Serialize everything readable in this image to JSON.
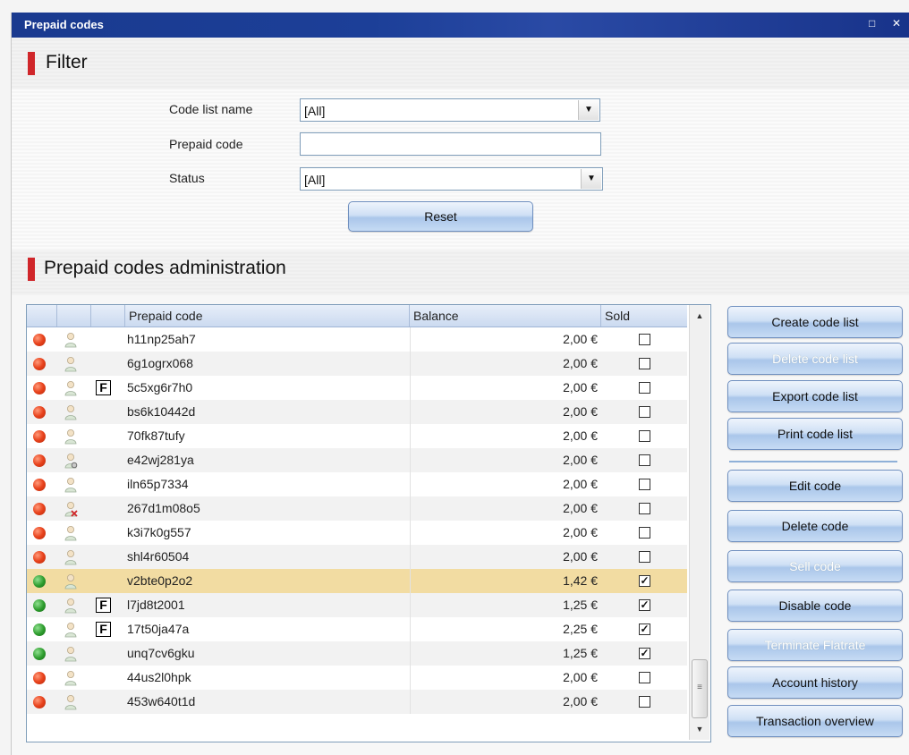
{
  "window": {
    "title": "Prepaid codes",
    "restore_icon": "□",
    "close_icon": "✕"
  },
  "filter": {
    "heading": "Filter",
    "code_list_name_label": "Code list name",
    "code_list_name_value": "[All]",
    "prepaid_code_label": "Prepaid code",
    "prepaid_code_value": "",
    "status_label": "Status",
    "status_value": "[All]",
    "reset_label": "Reset",
    "dropdown_glyph": "▼"
  },
  "admin": {
    "heading": "Prepaid codes administration",
    "columns": [
      "",
      "",
      "",
      "Prepaid code",
      "Balance",
      "Sold"
    ],
    "rows": [
      {
        "status": "red",
        "flag": "",
        "code": "h11np25ah7",
        "balance": "2,00 €",
        "sold": false,
        "user_icon": "user-icon"
      },
      {
        "status": "red",
        "flag": "",
        "code": "6g1ogrx068",
        "balance": "2,00 €",
        "sold": false,
        "user_icon": "user-icon"
      },
      {
        "status": "red",
        "flag": "F",
        "code": "5c5xg6r7h0",
        "balance": "2,00 €",
        "sold": false,
        "user_icon": "user-icon"
      },
      {
        "status": "red",
        "flag": "",
        "code": "bs6k10442d",
        "balance": "2,00 €",
        "sold": false,
        "user_icon": "user-icon"
      },
      {
        "status": "red",
        "flag": "",
        "code": "70fk87tufy",
        "balance": "2,00 €",
        "sold": false,
        "user_icon": "user-icon"
      },
      {
        "status": "red",
        "flag": "",
        "code": "e42wj281ya",
        "balance": "2,00 €",
        "sold": false,
        "user_icon": "user-settings-icon"
      },
      {
        "status": "red",
        "flag": "",
        "code": "iln65p7334",
        "balance": "2,00 €",
        "sold": false,
        "user_icon": "user-icon"
      },
      {
        "status": "red",
        "flag": "",
        "code": "267d1m08o5",
        "balance": "2,00 €",
        "sold": false,
        "user_icon": "user-blocked-icon"
      },
      {
        "status": "red",
        "flag": "",
        "code": "k3i7k0g557",
        "balance": "2,00 €",
        "sold": false,
        "user_icon": "user-icon"
      },
      {
        "status": "red",
        "flag": "",
        "code": "shl4r60504",
        "balance": "2,00 €",
        "sold": false,
        "user_icon": "user-icon"
      },
      {
        "status": "green",
        "flag": "",
        "code": "v2bte0p2o2",
        "balance": "1,42 €",
        "sold": true,
        "user_icon": "user-icon",
        "selected": true
      },
      {
        "status": "green",
        "flag": "F",
        "code": "l7jd8t2001",
        "balance": "1,25 €",
        "sold": true,
        "user_icon": "user-icon"
      },
      {
        "status": "green",
        "flag": "F",
        "code": "17t50ja47a",
        "balance": "2,25 €",
        "sold": true,
        "user_icon": "user-icon"
      },
      {
        "status": "green",
        "flag": "",
        "code": "unq7cv6gku",
        "balance": "1,25 €",
        "sold": true,
        "user_icon": "user-icon"
      },
      {
        "status": "red",
        "flag": "",
        "code": "44us2l0hpk",
        "balance": "2,00 €",
        "sold": false,
        "user_icon": "user-icon"
      },
      {
        "status": "red",
        "flag": "",
        "code": "453w640t1d",
        "balance": "2,00 €",
        "sold": false,
        "user_icon": "user-icon"
      }
    ]
  },
  "actions": {
    "create_code_list": "Create code list",
    "delete_code_list": "Delete code list",
    "export_code_list": "Export code list",
    "print_code_list": "Print code list",
    "edit_code": "Edit code",
    "delete_code": "Delete code",
    "sell_code": "Sell code",
    "disable_code": "Disable code",
    "terminate_flatrate": "Terminate Flatrate",
    "account_history": "Account history",
    "transaction_overview": "Transaction overview"
  },
  "scrollbar": {
    "up_glyph": "▲",
    "down_glyph": "▼",
    "thumb_glyph": "≡"
  },
  "colors": {
    "accent_red": "#d0262a",
    "selected_row": "#f2dca2",
    "title_bar": "#1c3f98"
  }
}
